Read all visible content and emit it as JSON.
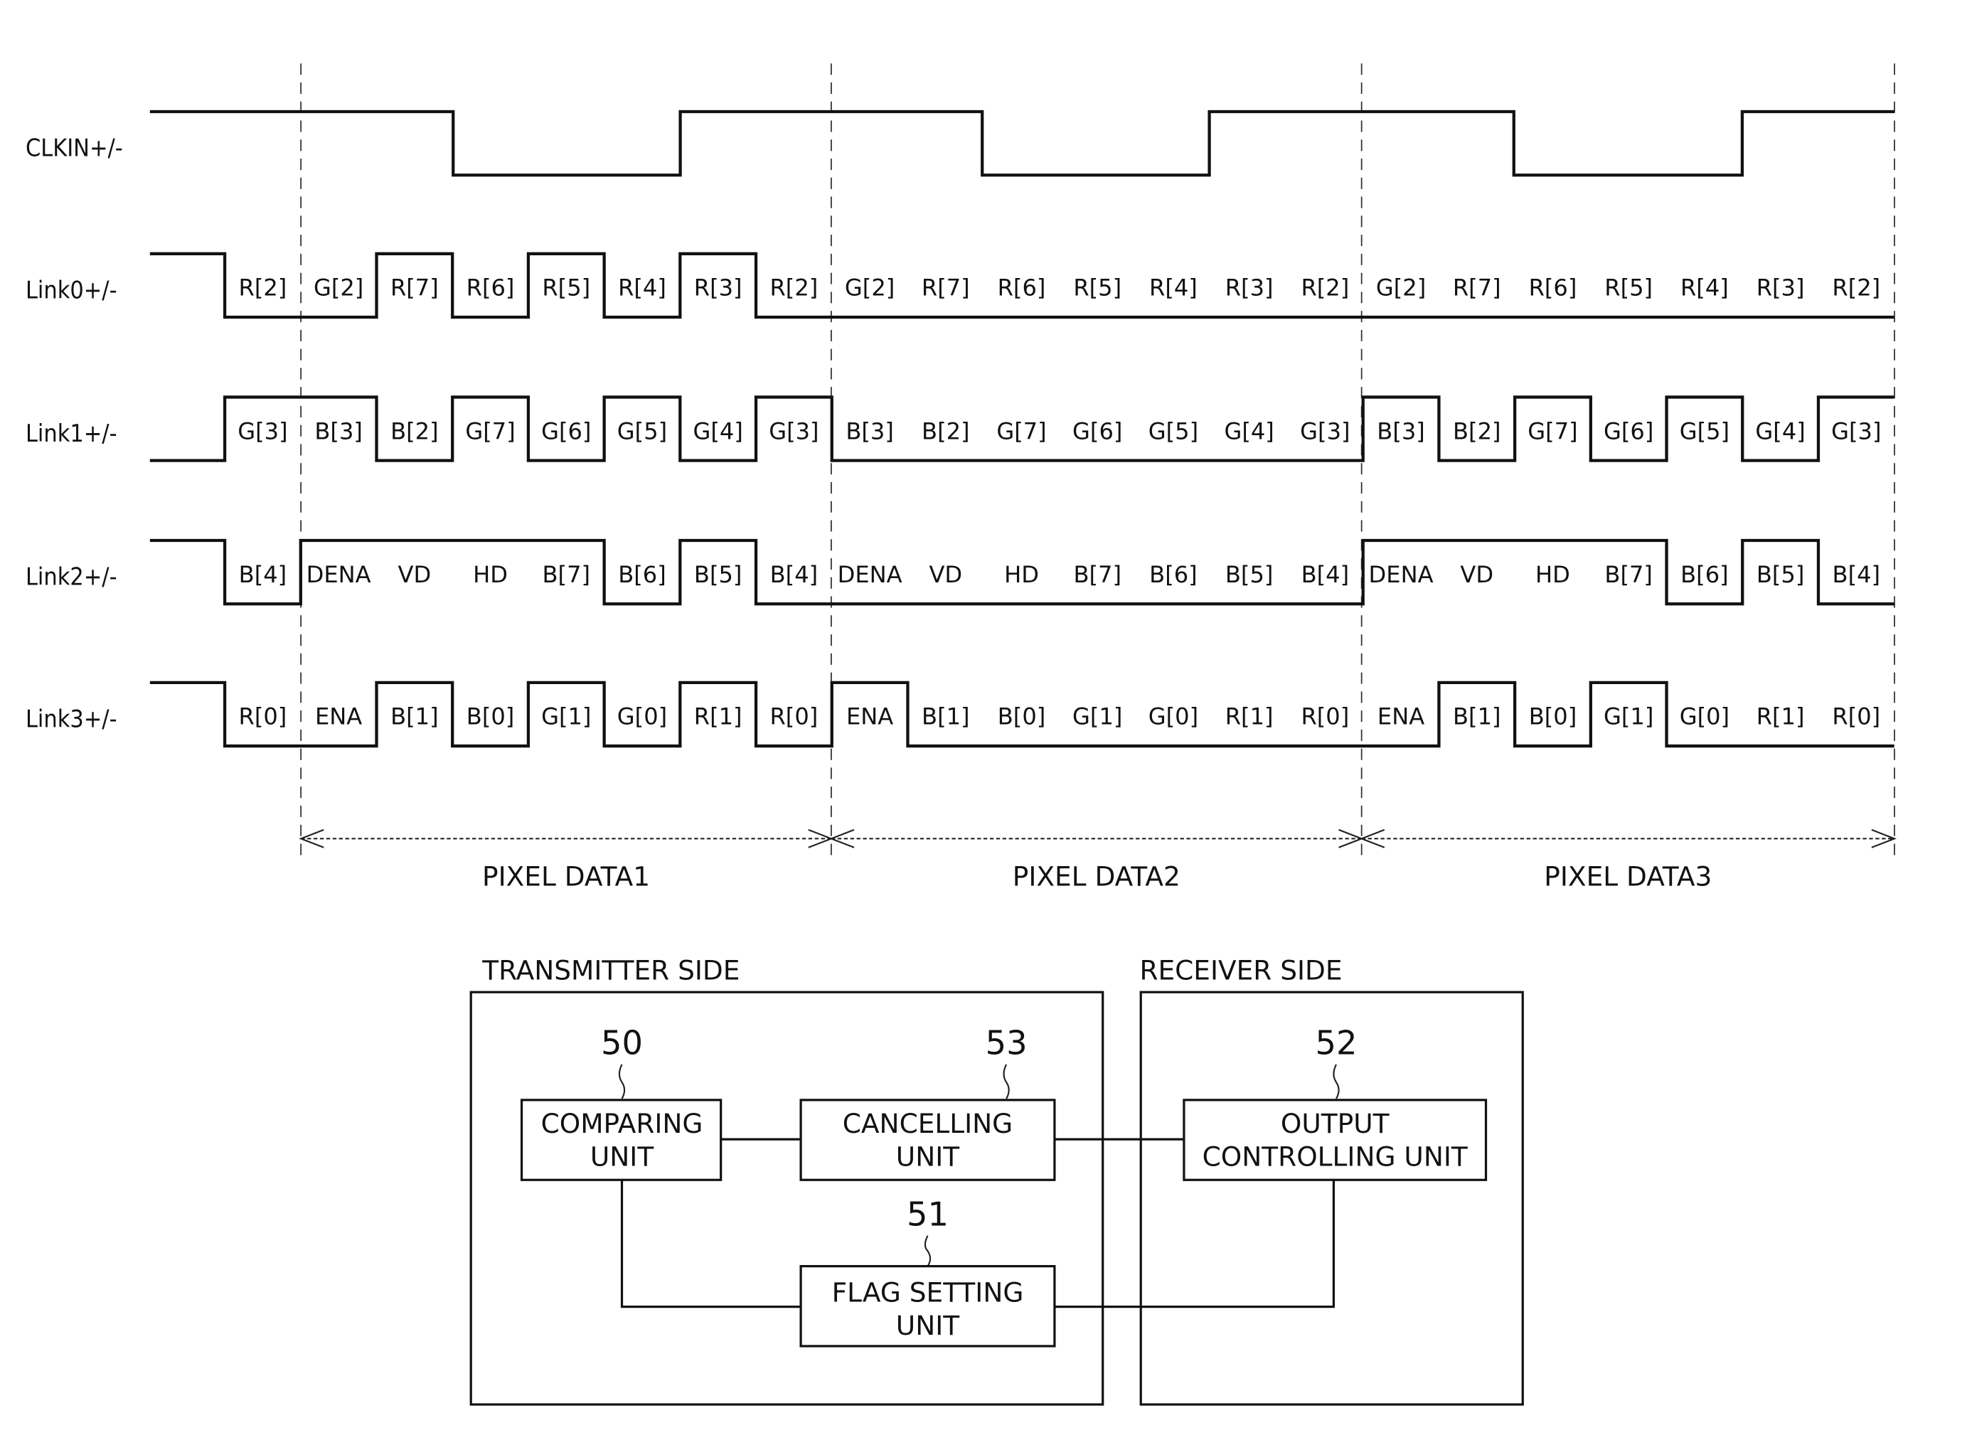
{
  "timing": {
    "signals": [
      {
        "name": "CLKIN+/-",
        "type": "clock",
        "levels_per_half": [
          "H",
          "H",
          "H",
          "L",
          "L",
          "L",
          "H",
          "H",
          "H",
          "L",
          "L",
          "L",
          "H",
          "H",
          "H",
          "L",
          "L",
          "L",
          "H",
          "H"
        ]
      },
      {
        "name": "Link0+/-",
        "initial": "H",
        "levels": [
          "L",
          "L",
          "H",
          "L",
          "H",
          "L",
          "H",
          "L",
          "L",
          "L",
          "L",
          "L",
          "L",
          "L",
          "L",
          "L",
          "L",
          "L",
          "L",
          "L",
          "L",
          "L"
        ],
        "labels": [
          "R[2]",
          "G[2]",
          "R[7]",
          "R[6]",
          "R[5]",
          "R[4]",
          "R[3]",
          "R[2]",
          "G[2]",
          "R[7]",
          "R[6]",
          "R[5]",
          "R[4]",
          "R[3]",
          "R[2]",
          "G[2]",
          "R[7]",
          "R[6]",
          "R[5]",
          "R[4]",
          "R[3]",
          "R[2]"
        ]
      },
      {
        "name": "Link1+/-",
        "initial": "L",
        "levels": [
          "H",
          "H",
          "L",
          "H",
          "L",
          "H",
          "L",
          "H",
          "L",
          "L",
          "L",
          "L",
          "L",
          "L",
          "L",
          "H",
          "L",
          "H",
          "L",
          "H",
          "L",
          "H"
        ],
        "labels": [
          "G[3]",
          "B[3]",
          "B[2]",
          "G[7]",
          "G[6]",
          "G[5]",
          "G[4]",
          "G[3]",
          "B[3]",
          "B[2]",
          "G[7]",
          "G[6]",
          "G[5]",
          "G[4]",
          "G[3]",
          "B[3]",
          "B[2]",
          "G[7]",
          "G[6]",
          "G[5]",
          "G[4]",
          "G[3]"
        ]
      },
      {
        "name": "Link2+/-",
        "initial": "H",
        "levels": [
          "L",
          "H",
          "H",
          "H",
          "H",
          "L",
          "H",
          "L",
          "L",
          "L",
          "L",
          "L",
          "L",
          "L",
          "L",
          "H",
          "H",
          "H",
          "H",
          "L",
          "H",
          "L"
        ],
        "labels": [
          "B[4]",
          "DENA",
          "VD",
          "HD",
          "B[7]",
          "B[6]",
          "B[5]",
          "B[4]",
          "DENA",
          "VD",
          "HD",
          "B[7]",
          "B[6]",
          "B[5]",
          "B[4]",
          "DENA",
          "VD",
          "HD",
          "B[7]",
          "B[6]",
          "B[5]",
          "B[4]"
        ]
      },
      {
        "name": "Link3+/-",
        "initial": "H",
        "levels": [
          "L",
          "L",
          "H",
          "L",
          "H",
          "L",
          "H",
          "L",
          "H",
          "L",
          "L",
          "L",
          "L",
          "L",
          "L",
          "L",
          "H",
          "L",
          "H",
          "L",
          "L",
          "L"
        ],
        "labels": [
          "R[0]",
          "ENA",
          "B[1]",
          "B[0]",
          "G[1]",
          "G[0]",
          "R[1]",
          "R[0]",
          "ENA",
          "B[1]",
          "B[0]",
          "G[1]",
          "G[0]",
          "R[1]",
          "R[0]",
          "ENA",
          "B[1]",
          "B[0]",
          "G[1]",
          "G[0]",
          "R[1]",
          "R[0]"
        ]
      }
    ],
    "pixel_periods": [
      "PIXEL DATA1",
      "PIXEL DATA2",
      "PIXEL DATA3"
    ]
  },
  "block_diagram": {
    "transmitter_label": "TRANSMITTER SIDE",
    "receiver_label": "RECEIVER SIDE",
    "units": [
      {
        "id": "50",
        "lines": [
          "COMPARING",
          "UNIT"
        ]
      },
      {
        "id": "53",
        "lines": [
          "CANCELLING",
          "UNIT"
        ]
      },
      {
        "id": "52",
        "lines": [
          "OUTPUT",
          "CONTROLLING UNIT"
        ]
      },
      {
        "id": "51",
        "lines": [
          "FLAG SETTING",
          "UNIT"
        ]
      }
    ]
  }
}
